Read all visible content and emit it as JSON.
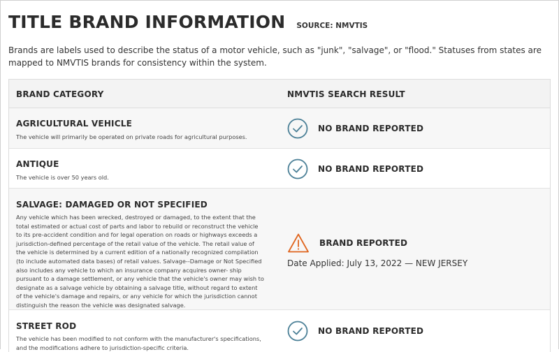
{
  "header": {
    "title": "TITLE BRAND INFORMATION",
    "source": "SOURCE: NMVTIS"
  },
  "intro": "Brands are labels used to describe the status of a motor vehicle, such as \"junk\", \"salvage\", or \"flood.\" Statuses from states are mapped to NMVTIS brands for consistency within the system.",
  "table": {
    "col_category": "BRAND CATEGORY",
    "col_result": "NMVTIS SEARCH RESULT",
    "rows": [
      {
        "title": "AGRICULTURAL VEHICLE",
        "desc": "The vehicle will primarily be operated on private roads for agricultural purposes.",
        "result": "NO BRAND REPORTED",
        "icon": "check-circle-icon"
      },
      {
        "title": "ANTIQUE",
        "desc": "The vehicle is over 50 years old.",
        "result": "NO BRAND REPORTED",
        "icon": "check-circle-icon"
      },
      {
        "title": "SALVAGE: DAMAGED OR NOT SPECIFIED",
        "desc": "Any vehicle which has been wrecked, destroyed or damaged, to the extent that the total estimated or actual cost of parts and labor to rebuild or reconstruct the vehicle to its pre-accident condition and for legal operation on roads or highways exceeds a jurisdiction-defined percentage of the retail value of the vehicle. The retail value of the vehicle is determined by a current edition of a nationally recognized compilation (to include automated data bases) of retail values. Salvage--Damage or Not Specified also includes any vehicle to which an insurance company acquires owner- ship pursuant to a damage settlement, or any vehicle that the vehicle's owner may wish to designate as a salvage vehicle by obtaining a salvage title, without regard to extent of the vehicle's damage and repairs, or any vehicle for which the jurisdiction cannot distinguish the reason the vehicle was designated salvage.",
        "result": "BRAND REPORTED",
        "icon": "warning-triangle-icon",
        "applied": "Date Applied: July 13, 2022 — NEW JERSEY"
      },
      {
        "title": "STREET ROD",
        "desc": "The vehicle has been modified to not conform with the manufacturer's specifications, and the modifications adhere to jurisdiction-specific criteria.",
        "result": "NO BRAND REPORTED",
        "icon": "check-circle-icon"
      }
    ]
  },
  "colors": {
    "check": "#4a7f96",
    "warning": "#e0651e",
    "header_bg": "#f3f3f3"
  }
}
